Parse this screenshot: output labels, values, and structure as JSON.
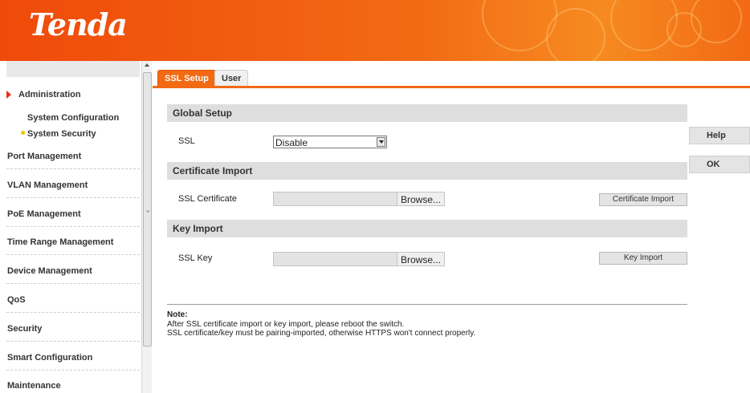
{
  "header": {
    "logo": "Tenda"
  },
  "sidebar": {
    "section_title": "Administration",
    "subitems": [
      "System Configuration",
      "System Security"
    ],
    "items": [
      "Port Management",
      "VLAN Management",
      "PoE Management",
      "Time Range Management",
      "Device Management",
      "QoS",
      "Security",
      "Smart Configuration",
      "Maintenance"
    ],
    "active_subitem": "System Security"
  },
  "tabs": [
    {
      "label": "SSL Setup",
      "active": true
    },
    {
      "label": "User",
      "active": false
    }
  ],
  "global_setup": {
    "title": "Global Setup",
    "ssl_label": "SSL",
    "ssl_value": "Disable"
  },
  "certificate_import": {
    "title": "Certificate Import",
    "field_label": "SSL Certificate",
    "browse_label": "Browse...",
    "button_label": "Certificate Import"
  },
  "key_import": {
    "title": "Key Import",
    "field_label": "SSL Key",
    "browse_label": "Browse...",
    "button_label": "Key Import"
  },
  "side_buttons": {
    "help": "Help",
    "ok": "OK"
  },
  "note": {
    "title": "Note:",
    "lines": [
      "After SSL certificate import or key import, please reboot the switch.",
      "SSL certificate/key must be pairing-imported, otherwise HTTPS won't connect properly."
    ]
  },
  "colors": {
    "accent": "#f26a14",
    "section_bg": "#dedede",
    "arrow": "#e8311a",
    "dot": "#f5c400"
  }
}
